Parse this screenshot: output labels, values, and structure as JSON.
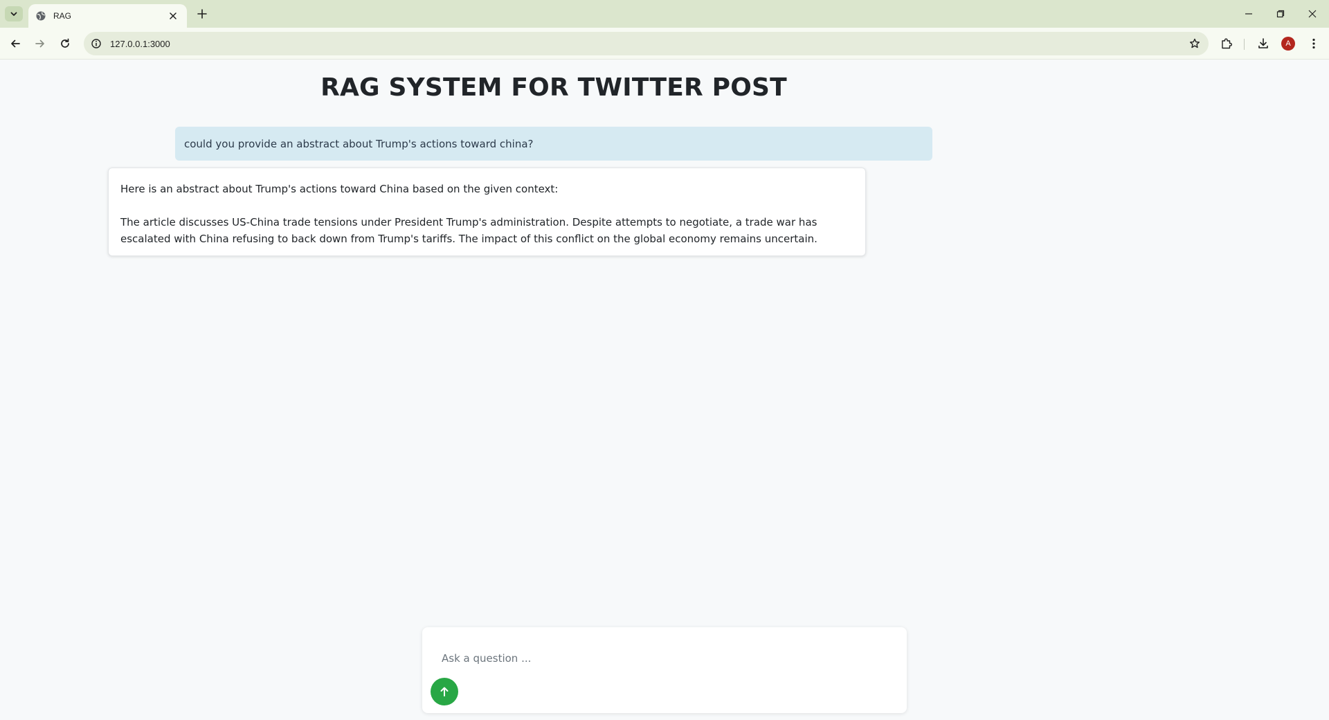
{
  "browser": {
    "tab_title": "RAG",
    "url": "127.0.0.1:3000",
    "profile_initial": "A"
  },
  "page": {
    "title": "RAG SYSTEM FOR TWITTER POST",
    "user_message": "could you provide an abstract about Trump's actions toward china?",
    "bot_message": {
      "paragraphs": [
        "Here is an abstract about Trump's actions toward China based on the given context:",
        "The article discusses US-China trade tensions under President Trump's administration. Despite attempts to negotiate, a trade war has escalated with China refusing to back down from Trump's tariffs. The impact of this conflict on the global economy remains uncertain."
      ]
    },
    "composer": {
      "placeholder": "Ask a question ..."
    }
  },
  "colors": {
    "send_button": "#28a745",
    "user_bubble": "#d6eaf2",
    "tabbar": "#dbe6cd"
  }
}
